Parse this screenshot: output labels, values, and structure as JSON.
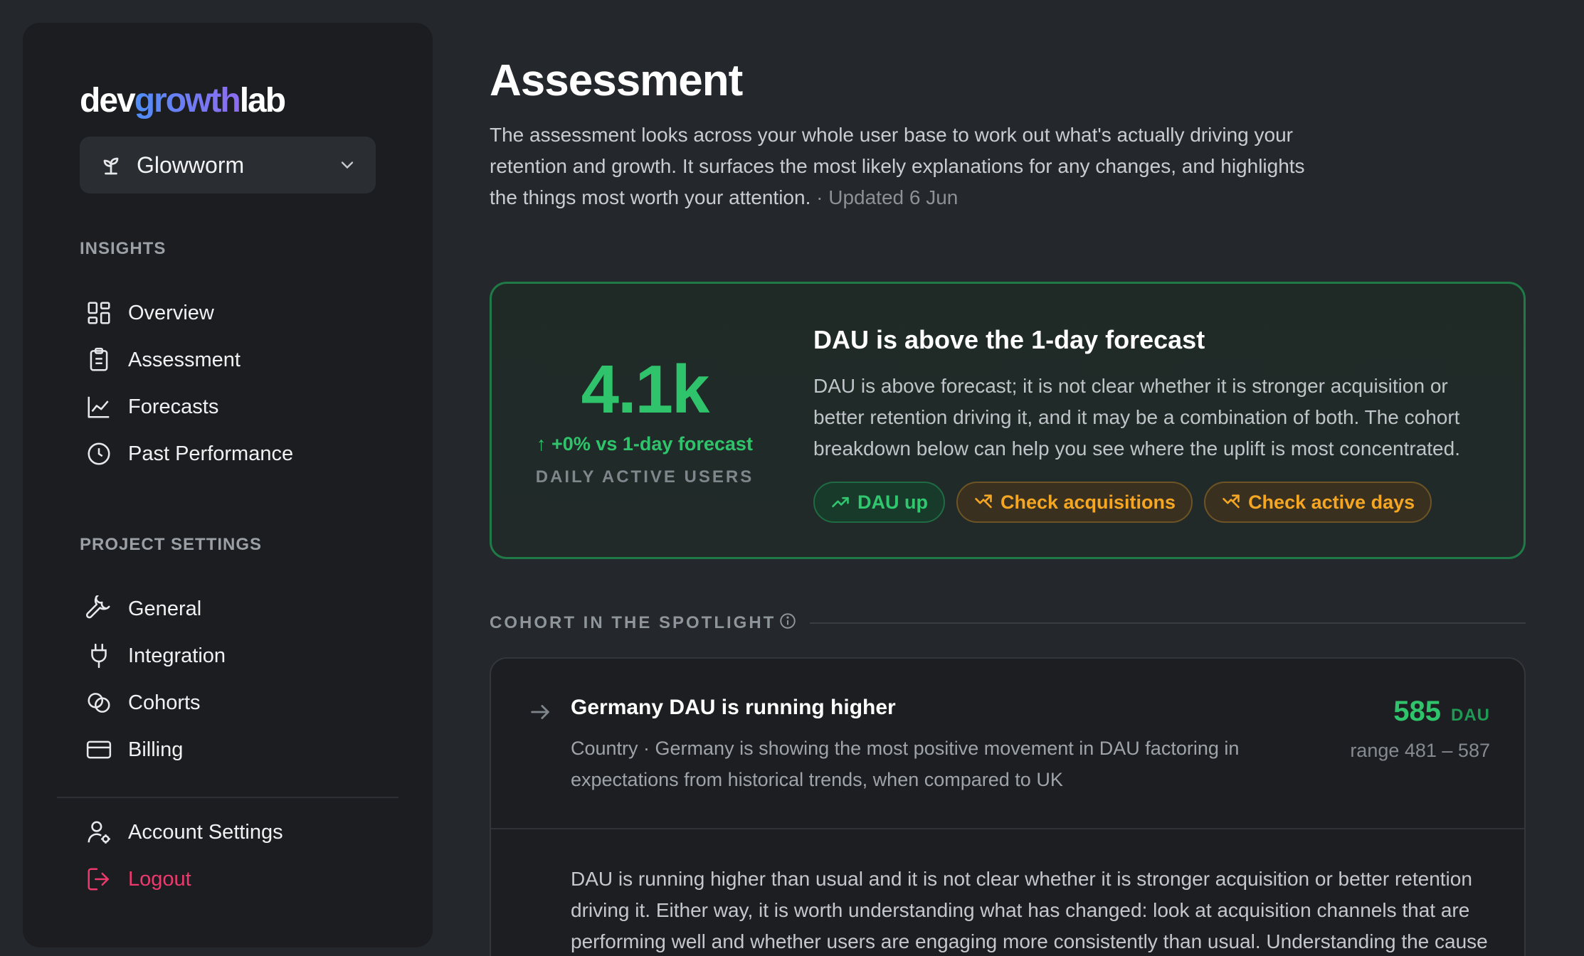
{
  "brand": {
    "logo_part1": "dev",
    "logo_part2": "growth",
    "logo_part3": "lab"
  },
  "project": {
    "name": "Glowworm"
  },
  "sidebar": {
    "insights_label": "INSIGHTS",
    "insights": [
      {
        "label": "Overview",
        "icon": "grid-icon"
      },
      {
        "label": "Assessment",
        "icon": "clipboard-icon"
      },
      {
        "label": "Forecasts",
        "icon": "line-chart-icon"
      },
      {
        "label": "Past Performance",
        "icon": "clock-icon"
      }
    ],
    "settings_label": "PROJECT SETTINGS",
    "settings": [
      {
        "label": "General",
        "icon": "wrench-icon"
      },
      {
        "label": "Integration",
        "icon": "plug-icon"
      },
      {
        "label": "Cohorts",
        "icon": "circles-icon"
      },
      {
        "label": "Billing",
        "icon": "card-icon"
      }
    ],
    "account": {
      "label": "Account Settings",
      "icon": "user-gear-icon"
    },
    "logout": {
      "label": "Logout",
      "icon": "logout-icon"
    }
  },
  "page": {
    "title": "Assessment",
    "intro": "The assessment looks across your whole user base to work out what's actually driving your retention and growth. It surfaces the most likely explanations for any changes, and highlights the things most worth your attention.",
    "updated": "· Updated 6 Jun"
  },
  "hero": {
    "value": "4.1k",
    "delta": "↑ +0% vs 1-day forecast",
    "caption": "DAILY ACTIVE USERS",
    "title": "DAU is above the 1-day forecast",
    "body": "DAU is above forecast; it is not clear whether it is stronger acquisition or better retention driving it, and it may be a combination of both. The cohort breakdown below can help you see where the uplift is most concentrated.",
    "chips": [
      "DAU up",
      "Check acquisitions",
      "Check active days"
    ]
  },
  "spotlight": {
    "label": "COHORT IN THE SPOTLIGHT",
    "title": "Germany DAU is running higher",
    "description": "Country · Germany is showing the most positive movement in DAU factoring in expectations from historical trends, when compared to UK",
    "value": "585",
    "unit": "DAU",
    "range": "range 481 – 587",
    "detail": "DAU is running higher than usual and it is not clear whether it is stronger acquisition or better retention driving it. Either way, it is worth understanding what has changed: look at acquisition channels that are performing well and whether users are engaging more consistently than usual. Understanding the cause"
  },
  "colors": {
    "accent_green": "#2fc46b",
    "amber": "#f5a623",
    "logout": "#ec3a6e"
  }
}
